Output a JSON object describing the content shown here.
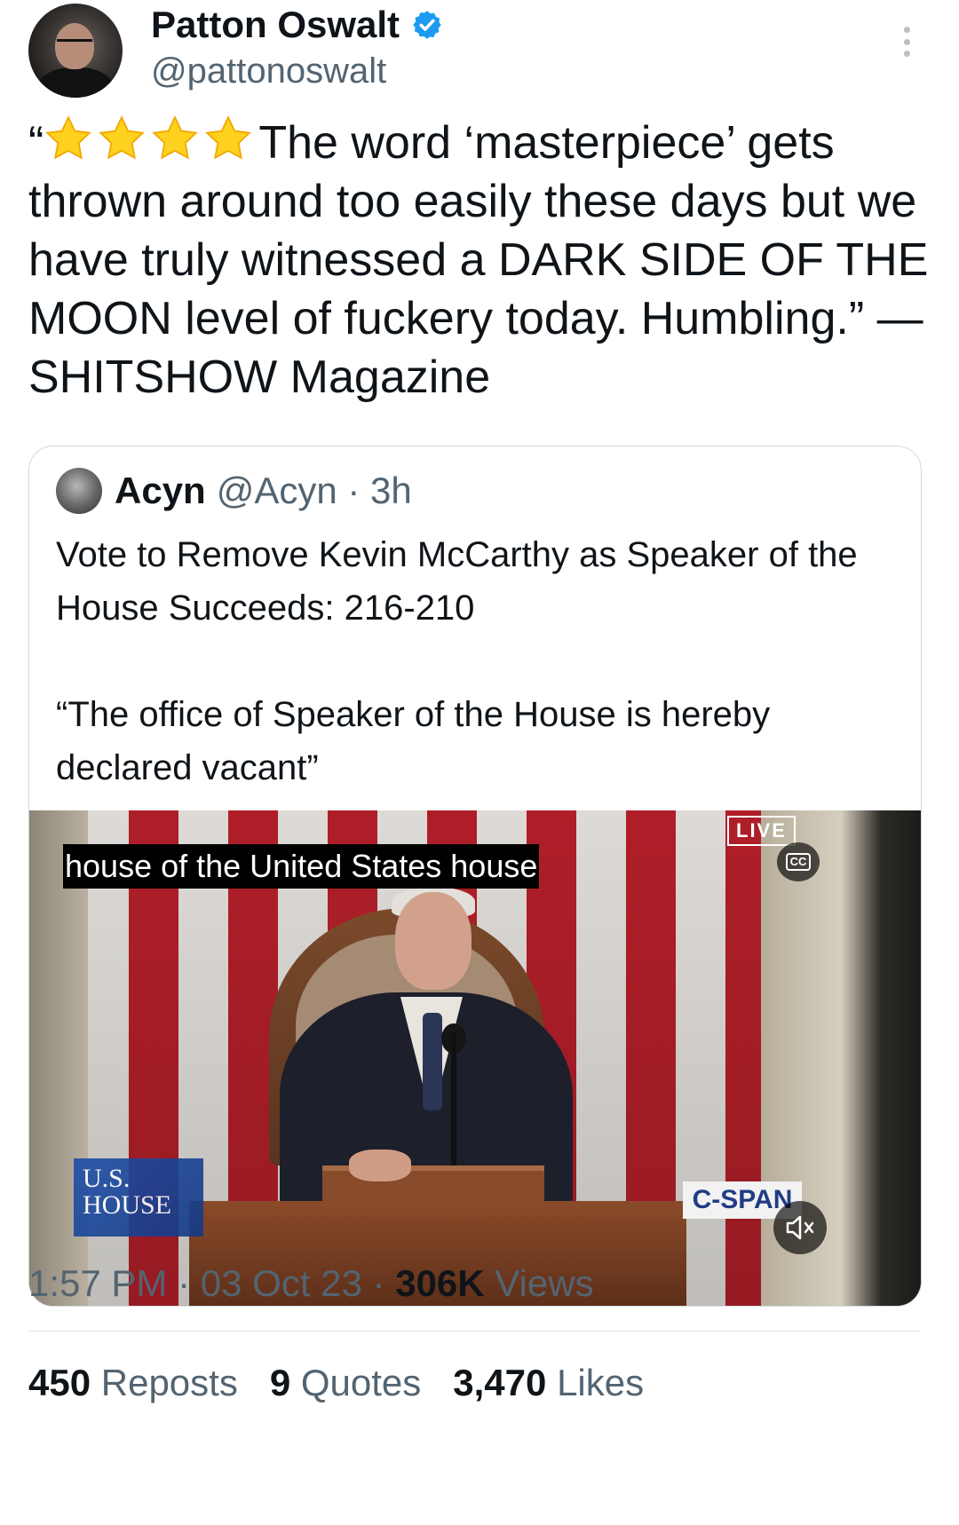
{
  "author": {
    "display_name": "Patton Oswalt",
    "handle": "@pattonoswalt",
    "verified": true
  },
  "tweet": {
    "open_quote": "“",
    "star_rating": 4,
    "text": "The word ‘masterpiece’ gets thrown around too easily these days but we have truly witnessed a DARK SIDE OF THE MOON level of fuckery today. Humbling.” — SHITSHOW Magazine"
  },
  "quoted": {
    "name": "Acyn",
    "handle_time": "@Acyn · 3h",
    "line1": "Vote to Remove Kevin McCarthy as Speaker of the House Succeeds: 216-210",
    "line2": "“The office of Speaker of the House is hereby declared vacant”",
    "video": {
      "live_label": "LIVE",
      "caption": "house of the United States house",
      "cc_label": "CC",
      "network_logo": "C-SPAN",
      "ush_line1": "U.S.",
      "ush_line2": "HOUSE"
    }
  },
  "meta": {
    "time": "1:57 PM",
    "sep1": "·",
    "date": "03 Oct 23",
    "sep2": "·",
    "views_count": "306K",
    "views_label": "Views"
  },
  "stats": {
    "reposts_count": "450",
    "reposts_label": "Reposts",
    "quotes_count": "9",
    "quotes_label": "Quotes",
    "likes_count": "3,470",
    "likes_label": "Likes"
  },
  "colors": {
    "text": "#0f1419",
    "secondary": "#536471",
    "verified": "#1d9bf0",
    "star": "#ffd21f"
  }
}
